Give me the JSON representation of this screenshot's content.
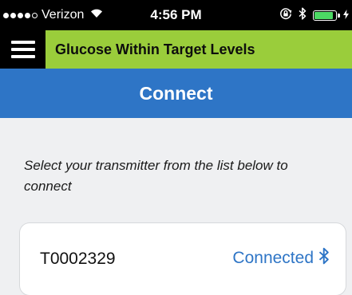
{
  "status_bar": {
    "signal_bars_filled": 4,
    "signal_bars_total": 5,
    "carrier": "Verizon",
    "wifi_icon": "wifi-icon",
    "time": "4:56 PM",
    "lock_icon": "rotation-lock-icon",
    "bluetooth_icon": "bluetooth-icon",
    "battery_icon": "battery-charging-icon",
    "battery_level": 0.9,
    "battery_color": "#4cd964"
  },
  "banner": {
    "menu_icon": "hamburger-menu-icon",
    "text": "Glucose Within Target Levels",
    "color": "#9acd3b"
  },
  "nav": {
    "title": "Connect",
    "color": "#2e75c6"
  },
  "instructions": "Select your transmitter from the list below to connect",
  "transmitters": [
    {
      "id": "T0002329",
      "status": "Connected",
      "status_icon": "bluetooth-icon"
    }
  ]
}
